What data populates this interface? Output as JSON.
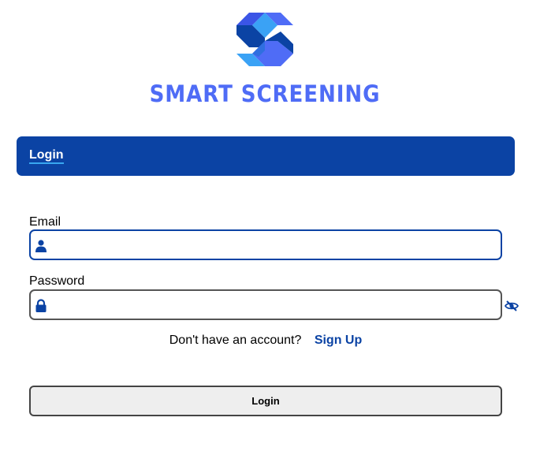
{
  "brand": {
    "name": "SMART SCREENING",
    "logo_icon": "s-cube-logo-icon",
    "colors": {
      "primary": "#0b43a4",
      "accent": "#4f6cf6",
      "light": "#3aa2f5"
    }
  },
  "header": {
    "title": "Login"
  },
  "form": {
    "email": {
      "label": "Email",
      "value": "",
      "placeholder": "",
      "icon": "user-icon"
    },
    "password": {
      "label": "Password",
      "value": "",
      "placeholder": "",
      "icon": "lock-icon",
      "toggle_icon": "eye-slash-icon"
    },
    "signup": {
      "prompt": "Don't have an account?",
      "link": "Sign Up"
    },
    "submit_label": "Login"
  }
}
